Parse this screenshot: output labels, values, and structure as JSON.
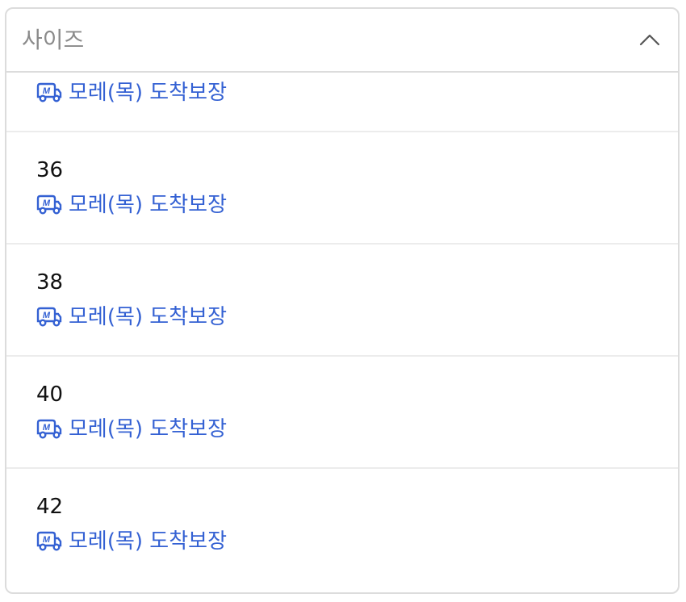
{
  "dropdown": {
    "title": "사이즈",
    "chevron_icon": "chevron-up-icon",
    "delivery_icon": "rocket-delivery-truck-icon",
    "accent_color": "#3461d3"
  },
  "options": [
    {
      "size": "",
      "delivery": "모레(목) 도착보장"
    },
    {
      "size": "36",
      "delivery": "모레(목) 도착보장"
    },
    {
      "size": "38",
      "delivery": "모레(목) 도착보장"
    },
    {
      "size": "40",
      "delivery": "모레(목) 도착보장"
    },
    {
      "size": "42",
      "delivery": "모레(목) 도착보장"
    }
  ]
}
